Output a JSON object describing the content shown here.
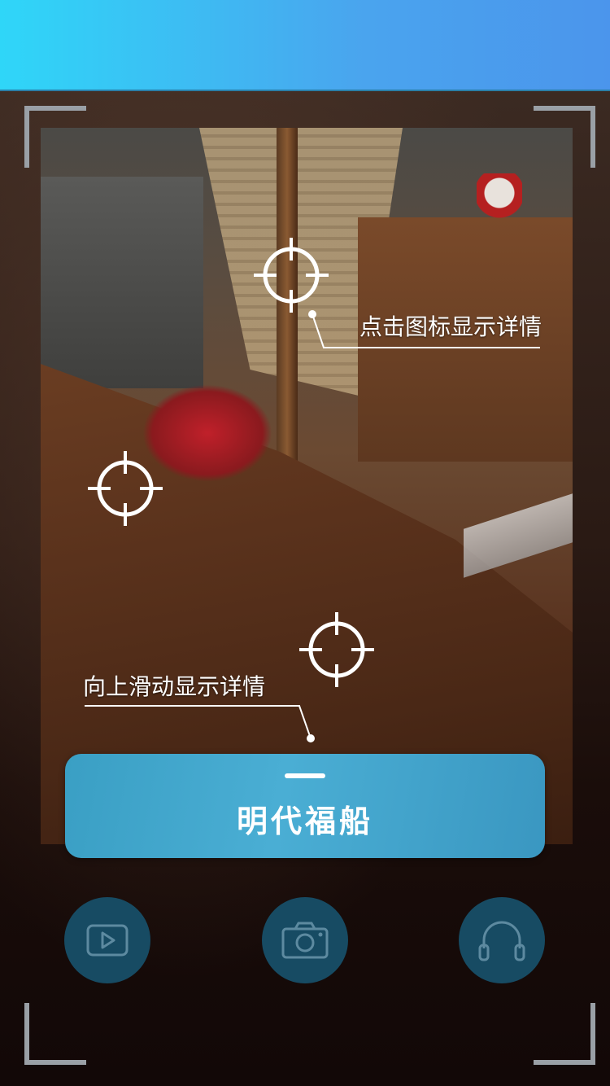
{
  "hints": {
    "tap_icon": "点击图标显示详情",
    "swipe_up": "向上滑动显示详情"
  },
  "card": {
    "title": "明代福船"
  },
  "actions": [
    {
      "name": "video",
      "icon": "play-video-icon"
    },
    {
      "name": "camera",
      "icon": "camera-icon"
    },
    {
      "name": "audio",
      "icon": "headphones-icon"
    }
  ],
  "colors": {
    "header_gradient_start": "#2fd6f8",
    "header_gradient_end": "#4b95ec",
    "card_blue": "#3a9fc4",
    "action_button": "#174b63"
  }
}
